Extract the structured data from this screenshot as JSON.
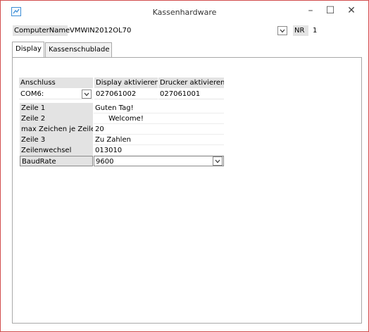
{
  "window": {
    "title": "Kassenhardware",
    "controls": {
      "minimize": "–",
      "maximize": "☐",
      "close": "✕"
    }
  },
  "computer": {
    "name_label": "ComputerName",
    "name_value": "VMWIN2012OL70",
    "nr_label": "NR",
    "nr_value": "1"
  },
  "tabs": [
    {
      "label": "Display",
      "active": true
    },
    {
      "label": "Kassenschublade",
      "active": false
    }
  ],
  "ports": {
    "headers": [
      "Anschluss",
      "Display aktivieren",
      "Drucker aktivieren"
    ],
    "row": [
      "COM6:",
      "027061002",
      "027061001"
    ]
  },
  "properties": [
    {
      "label": "Zeile 1",
      "value": "Guten Tag!"
    },
    {
      "label": "Zeile 2",
      "value": "      Welcome!"
    },
    {
      "label": "max Zeichen je Zeile",
      "value": "20"
    },
    {
      "label": "Zeile 3",
      "value": "Zu Zahlen"
    },
    {
      "label": "Zeilenwechsel",
      "value": "013010"
    },
    {
      "label": "BaudRate",
      "value": "9600"
    }
  ],
  "colors": {
    "window_border": "#d24e4e",
    "icon_accent": "#3f8fd6",
    "label_bg": "#e3e3e3"
  }
}
